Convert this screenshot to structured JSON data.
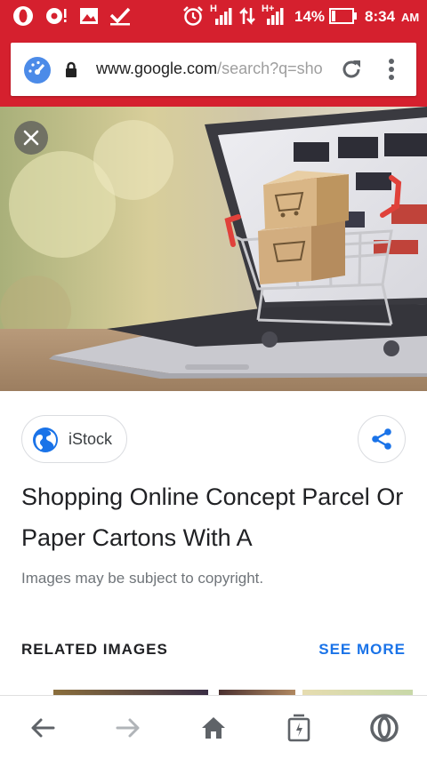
{
  "status_bar": {
    "network_label_1": "H",
    "network_label_2": "H+",
    "battery": "14%",
    "time": "8:34",
    "ampm": "AM"
  },
  "browser": {
    "url_host": "www.google.com",
    "url_path": "/search?q=sho",
    "icons": [
      "speed-dial-icon",
      "lock-icon",
      "reload-icon",
      "menu-icon"
    ]
  },
  "image_viewer": {
    "source": "iStock",
    "title": "Shopping Online Concept Parcel Or Paper Cartons With A",
    "copyright_notice": "Images may be subject to copyright.",
    "related_heading": "RELATED IMAGES",
    "see_more_label": "SEE MORE"
  },
  "colors": {
    "browser_red": "#d5202e",
    "link_blue": "#1a73e8",
    "text_dark": "#202124",
    "text_grey": "#70757a"
  },
  "bottom_nav": {
    "icons": [
      "back-arrow-icon",
      "forward-arrow-icon",
      "home-icon",
      "tabs-icon",
      "opera-icon"
    ]
  }
}
